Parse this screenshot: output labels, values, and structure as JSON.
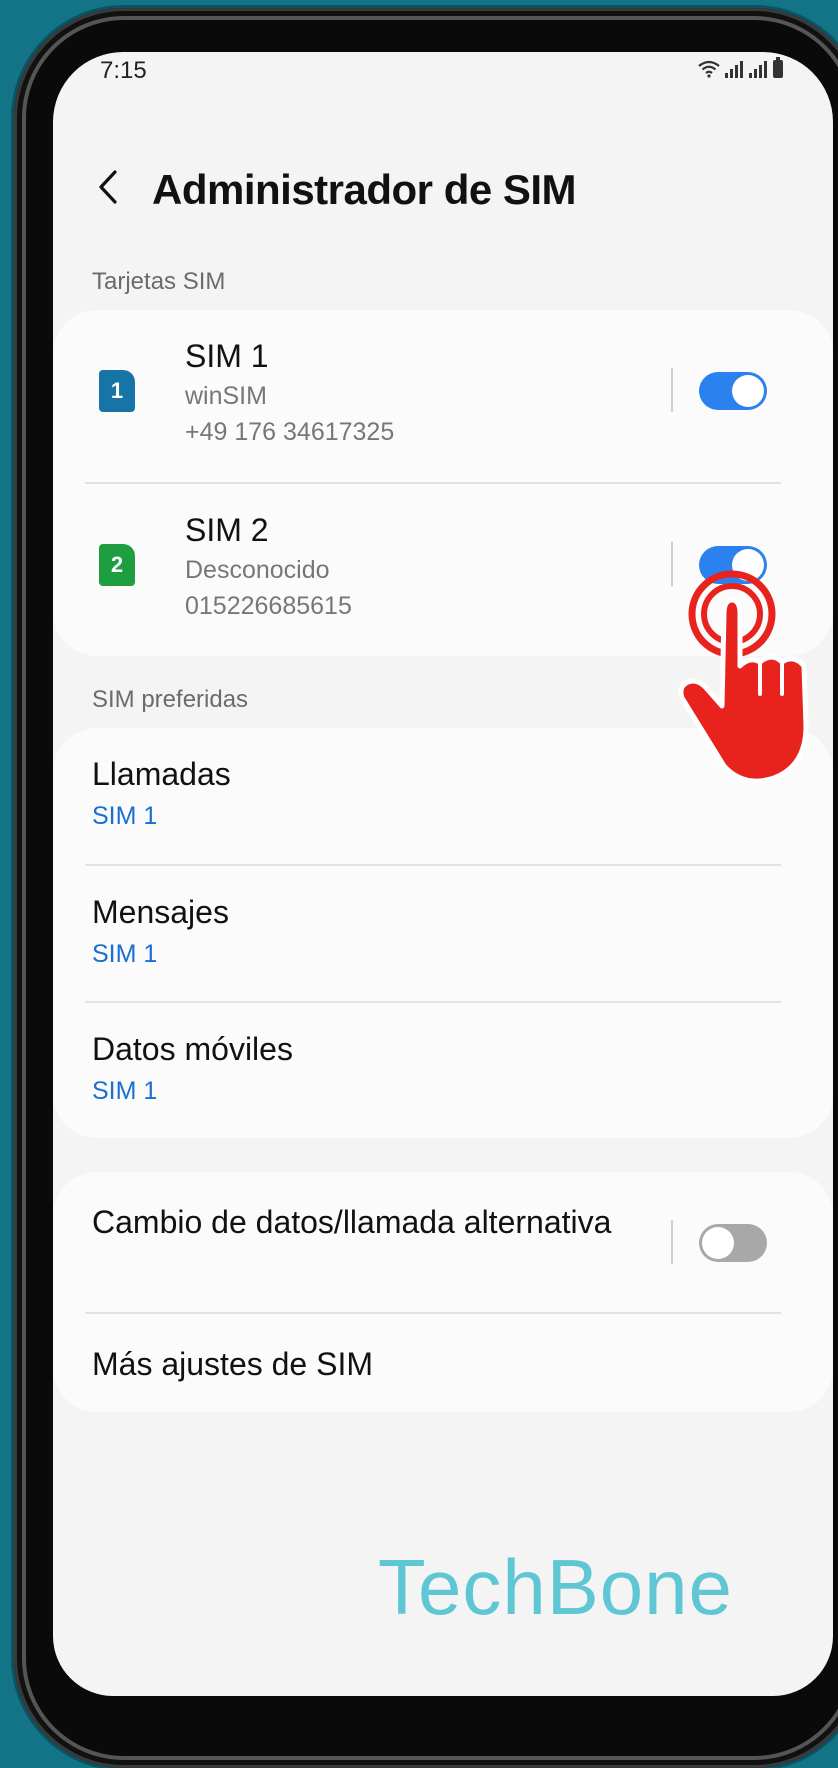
{
  "status_bar": {
    "time": "7:15"
  },
  "header": {
    "title": "Administrador de SIM"
  },
  "sections": {
    "sim_cards": "Tarjetas SIM",
    "preferred": "SIM preferidas"
  },
  "sims": [
    {
      "badge": "1",
      "name": "SIM 1",
      "carrier": "winSIM",
      "number": "+49 176 34617325",
      "enabled": true,
      "color": "#1774a7"
    },
    {
      "badge": "2",
      "name": "SIM 2",
      "carrier": "Desconocido",
      "number": "015226685615",
      "enabled": true,
      "color": "#1e9e3f"
    }
  ],
  "preferred": [
    {
      "title": "Llamadas",
      "value": "SIM 1"
    },
    {
      "title": "Mensajes",
      "value": "SIM 1"
    },
    {
      "title": "Datos móviles",
      "value": "SIM 1"
    }
  ],
  "alternate": {
    "title": "Cambio de datos/llamada alternativa",
    "enabled": false
  },
  "more": {
    "title": "Más ajustes de SIM"
  },
  "watermark": "TechBone",
  "colors": {
    "accent": "#2b82ee",
    "link": "#1a6fd1",
    "background": "#127486",
    "pointer": "#e8231e"
  }
}
